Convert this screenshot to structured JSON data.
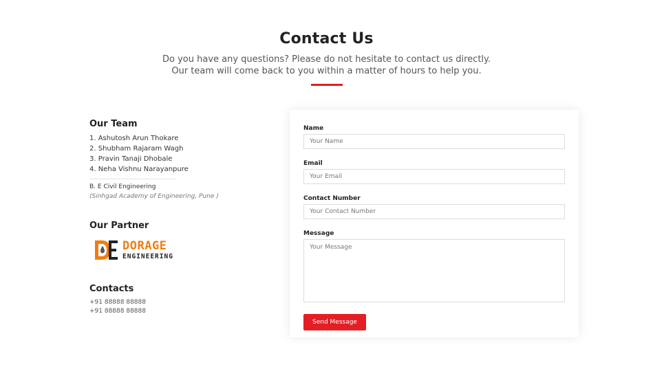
{
  "header": {
    "title": "Contact Us",
    "subtitle": "Do you have any questions? Please do not hesitate to contact us directly. Our team will come back to you within a matter of hours to help you."
  },
  "team": {
    "heading": "Our Team",
    "members": [
      "1. Ashutosh Arun Thokare",
      "2. Shubham Rajaram Wagh",
      "3. Pravin Tanaji Dhobale",
      "4. Neha Vishnu Narayanpure"
    ],
    "degree": "B. E Civil Engineering",
    "college": "(Sinhgad Academy of Engineering, Pune )"
  },
  "partner": {
    "heading": "Our Partner",
    "logo_line1": "DORAGE",
    "logo_line2": "ENGINEERING"
  },
  "contacts": {
    "heading": "Contacts",
    "phones": [
      "+91 88888 88888",
      "+91 88888 88888"
    ]
  },
  "form": {
    "name_label": "Name",
    "name_placeholder": "Your Name",
    "email_label": "Email",
    "email_placeholder": "Your Email",
    "contact_label": "Contact Number",
    "contact_placeholder": "Your Contact Number",
    "message_label": "Message",
    "message_placeholder": "Your Message",
    "submit_label": "Send Message"
  },
  "colors": {
    "accent": "#e31e24",
    "logo_orange": "#f07d12"
  }
}
